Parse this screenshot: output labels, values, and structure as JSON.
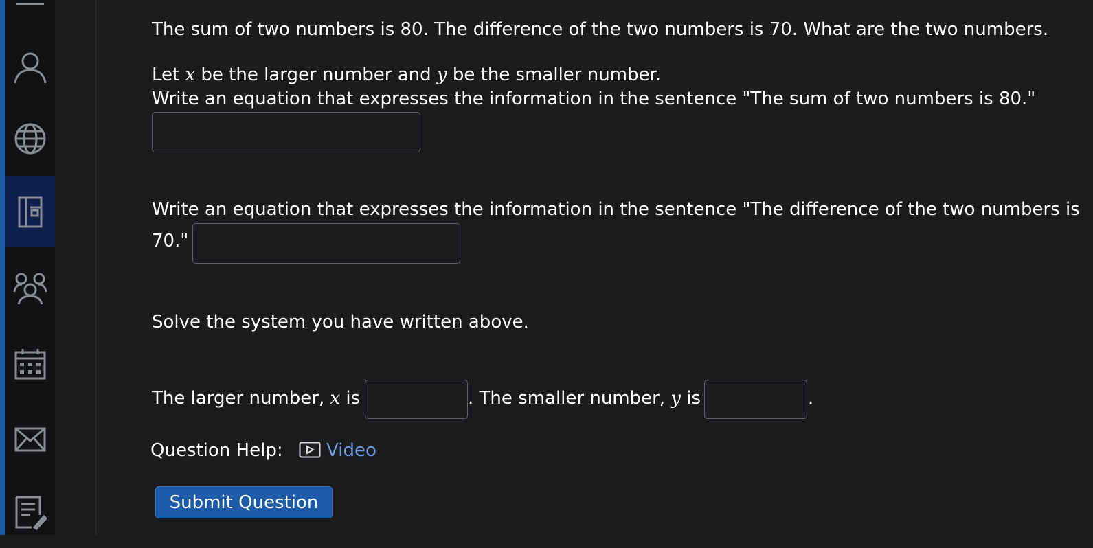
{
  "sidebar": {
    "items": [
      {
        "icon": "menu-icon"
      },
      {
        "icon": "user-icon"
      },
      {
        "icon": "globe-icon"
      },
      {
        "icon": "book-icon",
        "active": true
      },
      {
        "icon": "people-icon"
      },
      {
        "icon": "calendar-icon"
      },
      {
        "icon": "mail-icon"
      },
      {
        "icon": "notes-icon"
      }
    ]
  },
  "question": {
    "problem": "The sum of two numbers is 80. The difference of the two numbers is 70. What are the two numbers.",
    "let_prefix": "Let ",
    "var_x": "x",
    "let_mid": " be the larger number and ",
    "var_y": "y",
    "let_suffix": " be the smaller number.",
    "prompt1": "Write an equation that expresses the information in the sentence \"The sum of two numbers is 80.\"",
    "prompt2_line1": "Write an equation that expresses the information in the sentence \"The difference of the two numbers is",
    "prompt2_line2": "70.\"",
    "solve": "Solve the system you have written above.",
    "larger_prefix": "The larger number, ",
    "larger_suffix": " is",
    "smaller_prefix": ". The smaller number, ",
    "smaller_suffix": " is",
    "end_period": "."
  },
  "inputs": {
    "equation1": "",
    "equation2": "",
    "larger_answer": "",
    "smaller_answer": ""
  },
  "help": {
    "label": "Question Help:",
    "video_icon": "play-icon",
    "video_label": "Video"
  },
  "submit_label": "Submit Question",
  "colors": {
    "background": "#1b1c1e",
    "sidebar": "#111214",
    "accent": "#1c5aa3",
    "active_nav": "#0e1f4d",
    "link": "#6f9ae0",
    "button": "#1c5ba7"
  }
}
